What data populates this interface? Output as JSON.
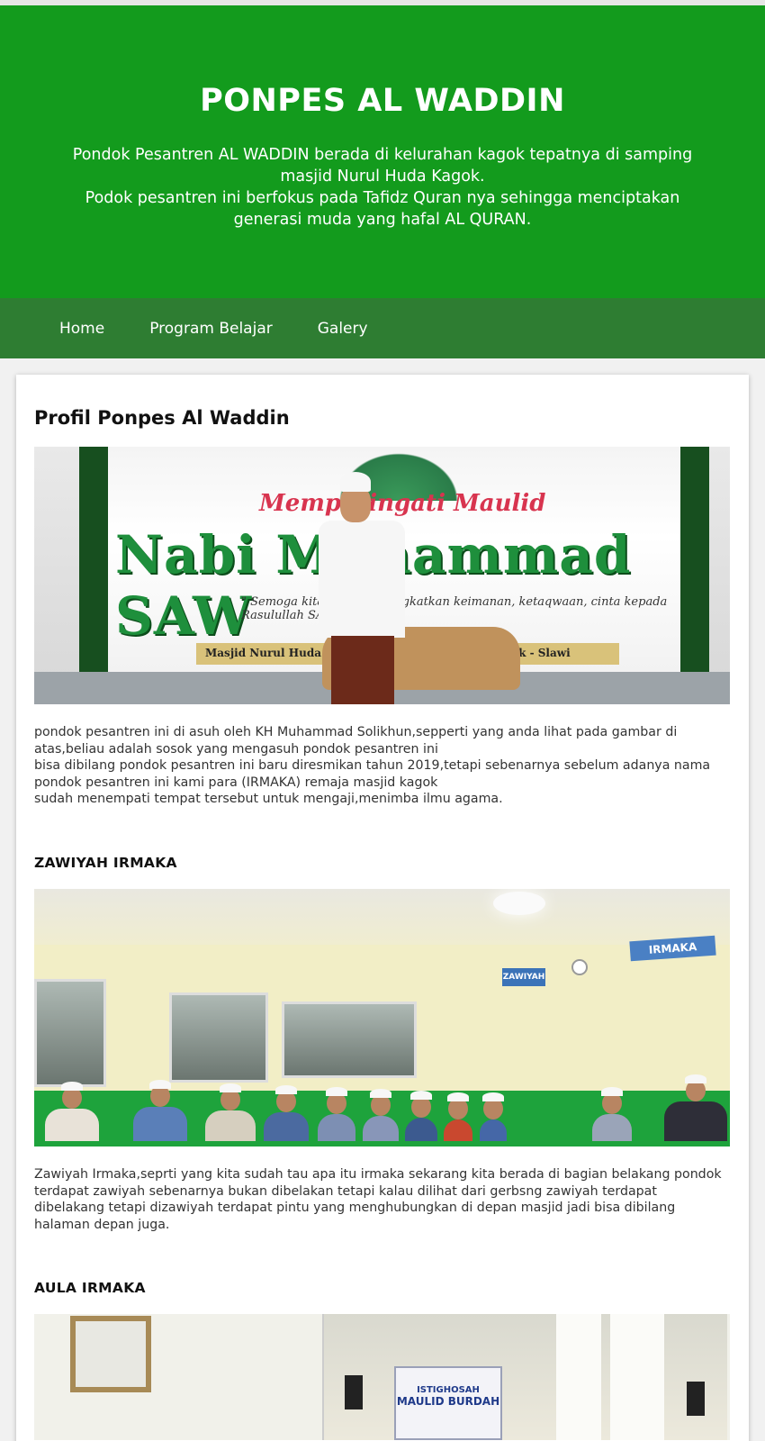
{
  "header": {
    "title": "PONPES AL WADDIN",
    "desc_line1": "Pondok Pesantren AL WADDIN berada di kelurahan kagok tepatnya di samping masjid Nurul Huda Kagok.",
    "desc_line2": "Podok pesantren ini berfokus pada Tafidz Quran nya sehingga menciptakan generasi muda yang hafal AL QURAN.",
    "bg_color": "#139b1d"
  },
  "nav": {
    "items": [
      "Home",
      "Program Belajar",
      "Galery"
    ],
    "bg_color": "#2e7d32"
  },
  "profil": {
    "heading": "Profil Ponpes Al Waddin",
    "photo": {
      "banner_line1": "Memperingati Maulid",
      "banner_line2": "Nabi Muhammad SAW",
      "banner_line3": "\" Semoga kita dapat meningkatkan keimanan, ketaqwaan, cinta kepada Rasulullah SAW",
      "banner_strip": "Masjid Nurul Huda Kagok · Ponpes Al Waddin Kagok - Slawi"
    },
    "text_lines": [
      "pondok pesantren ini di asuh oleh KH Muhammad Solikhun,sepperti yang anda lihat pada gambar di atas,beliau adalah sosok yang mengasuh pondok pesantren ini",
      "bisa dibilang pondok pesantren ini baru diresmikan tahun 2019,tetapi sebenarnya sebelum adanya nama pondok pesantren ini kami para (IRMAKA) remaja masjid kagok",
      "sudah menempati tempat tersebut untuk mengaji,menimba ilmu agama."
    ]
  },
  "zawiyah": {
    "heading": "ZAWIYAH IRMAKA",
    "photo": {
      "sign_small": "ZAWIYAH",
      "sign_large": "IRMAKA"
    },
    "text": "Zawiyah Irmaka,seprti yang kita sudah tau apa itu irmaka sekarang kita berada di bagian belakang pondok terdapat zawiyah sebenarnya bukan dibelakan tetapi kalau dilihat dari gerbsng zawiyah terdapat dibelakang tetapi dizawiyah terdapat pintu yang menghubungkan di depan masjid jadi bisa dibilang halaman depan juga."
  },
  "aula": {
    "heading": "AULA IRMAKA",
    "photo": {
      "poster_line1": "ISTIGHOSAH",
      "poster_line2": "MAULID BURDAH"
    }
  }
}
